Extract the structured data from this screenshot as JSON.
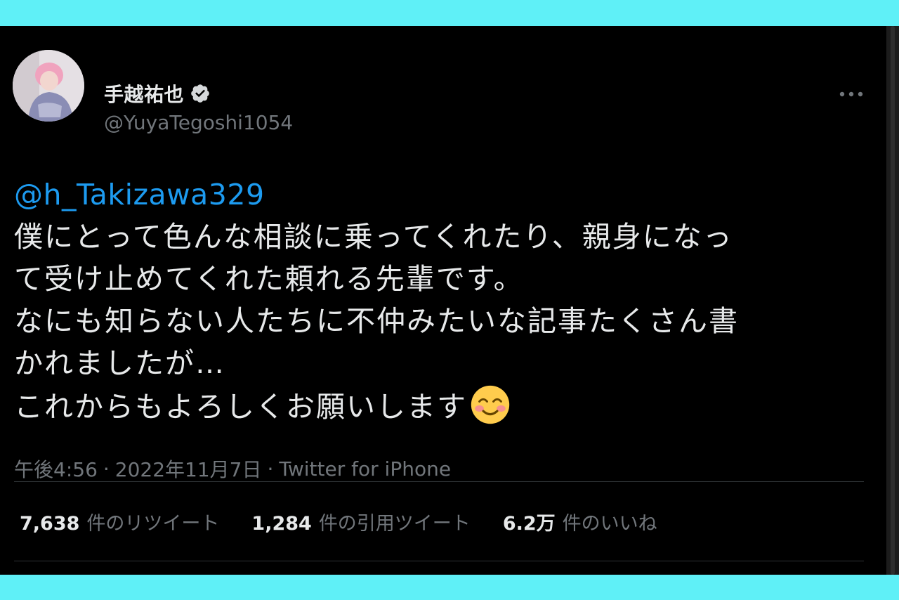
{
  "colors": {
    "frame": "#5ff0f7",
    "background": "#000000",
    "text": "#e7e9ea",
    "muted": "#71767b",
    "link": "#1d9bf0",
    "divider": "#2f3336",
    "verified_badge": "#d6d9db"
  },
  "author": {
    "display_name": "手越祐也",
    "handle": "@YuyaTegoshi1054",
    "verified": true,
    "verified_icon": "verified-badge-icon",
    "avatar_icon": "profile-photo"
  },
  "menu": {
    "icon": "more-horizontal-icon"
  },
  "tweet": {
    "mention": "@h_Takizawa329",
    "lines": [
      "僕にとって色んな相談に乗ってくれたり、親身になっ",
      "て受け止めてくれた頼れる先輩です。",
      "なにも知らない人たちに不仲みたいな記事たくさん書",
      "かれましたが…",
      "これからもよろしくお願いします"
    ],
    "emoji": "smiling-face-with-smiling-eyes-emoji"
  },
  "meta": {
    "time": "午後4:56",
    "separator": "·",
    "date": "2022年11月7日",
    "source": "Twitter for iPhone"
  },
  "stats": [
    {
      "value": "7,638",
      "label": "件のリツイート"
    },
    {
      "value": "1,284",
      "label": "件の引用ツイート"
    },
    {
      "value": "6.2万",
      "label": "件のいいね"
    }
  ]
}
